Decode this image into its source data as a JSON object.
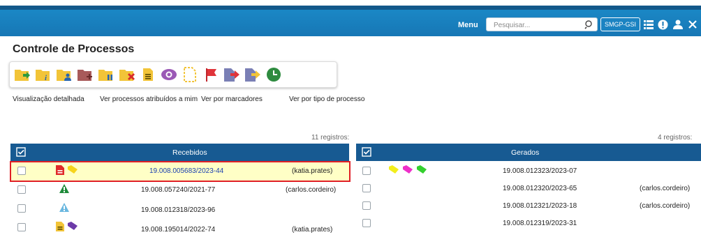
{
  "topbar": {
    "menu_label": "Menu",
    "search_placeholder": "Pesquisar...",
    "unit_label": "SMGP-GSI",
    "icons": [
      "list-icon",
      "alert-icon",
      "user-icon",
      "tools-icon",
      "power-icon"
    ]
  },
  "page_title": "Controle de Processos",
  "toolbar_icons": [
    "send-process-icon",
    "process-info-icon",
    "assign-process-icon",
    "attach-processes-icon",
    "suspend-process-icon",
    "conclude-process-icon",
    "annotation-icon",
    "view-icon",
    "new-document-icon",
    "marker-flag-icon",
    "forward-icon",
    "return-icon",
    "deadline-icon"
  ],
  "view_links": {
    "detailed": "Visualização detalhada",
    "assigned": "Ver processos atribuídos a mim",
    "markers": "Ver por marcadores",
    "type": "Ver por tipo de processo"
  },
  "received": {
    "count": "11 registros:",
    "header": "Recebidos",
    "rows": [
      {
        "process": "19.008.005683/2023-44",
        "user": "(katia.prates)",
        "icons": [
          "red-document-icon",
          "yellow-tag-icon"
        ],
        "selected": true
      },
      {
        "process": "19.008.057240/2021-77",
        "user": "(carlos.cordeiro)",
        "icons": [
          "green-warning-icon"
        ],
        "selected": false
      },
      {
        "process": "19.008.012318/2023-96",
        "user": "",
        "icons": [
          "blue-warning-icon"
        ],
        "selected": false
      },
      {
        "process": "19.008.195014/2022-74",
        "user": "(katia.prates)",
        "icons": [
          "yellow-document-icon",
          "purple-tag-icon"
        ],
        "selected": false
      }
    ]
  },
  "generated": {
    "count": "4 registros:",
    "header": "Gerados",
    "rows": [
      {
        "process": "19.008.012323/2023-07",
        "user": "",
        "icons": [
          "yellow-tag-icon",
          "magenta-tag-icon",
          "green-tag-icon"
        ]
      },
      {
        "process": "19.008.012320/2023-65",
        "user": "(carlos.cordeiro)",
        "icons": []
      },
      {
        "process": "19.008.012321/2023-18",
        "user": "(carlos.cordeiro)",
        "icons": []
      },
      {
        "process": "19.008.012319/2023-31",
        "user": "",
        "icons": []
      }
    ]
  },
  "colors": {
    "topbar": "#1b8ac8",
    "table_header": "#175a92",
    "selected_row": "#ffffc6",
    "selected_border": "#e01f26",
    "link": "#1a3fb0"
  }
}
